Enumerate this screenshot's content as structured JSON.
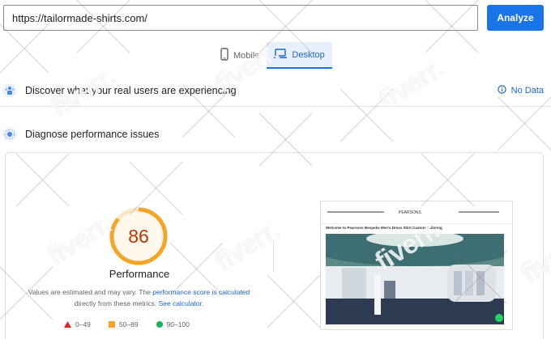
{
  "url_input": {
    "value": "https://tailormade-shirts.com/"
  },
  "analyze_button": {
    "label": "Analyze"
  },
  "device_tabs": [
    {
      "label": "Mobile",
      "icon": "smartphone-icon",
      "active": false
    },
    {
      "label": "Desktop",
      "icon": "laptop-icon",
      "active": true
    }
  ],
  "field_data": {
    "title": "Discover what your real users are experiencing",
    "status": "No Data"
  },
  "diagnose": {
    "title": "Diagnose performance issues"
  },
  "performance": {
    "score": "86",
    "score_fraction": 0.86,
    "label": "Performance",
    "disclaimer_start": "Values are estimated and may vary. The",
    "score_link": "performance score is calculated",
    "disclaimer_mid": "directly from these metrics.",
    "calculator_link": "See calculator",
    "disclaimer_end": "."
  },
  "legend": [
    {
      "range": "0–49",
      "shape": "triangle",
      "color": "#e8211f"
    },
    {
      "range": "50–89",
      "shape": "square",
      "color": "#f4a528"
    },
    {
      "range": "90–100",
      "shape": "circle",
      "color": "#18b55a"
    }
  ],
  "screenshot": {
    "headline": "Welcome to Pearsons Bespoke Men's Dress Shirt Custom Tailoring",
    "brand": "PEARSONS"
  },
  "watermark": {
    "text": "fiverr."
  },
  "colors": {
    "accent": "#1a73e8",
    "score_orange": "#f4a528",
    "score_text": "#c33300"
  }
}
